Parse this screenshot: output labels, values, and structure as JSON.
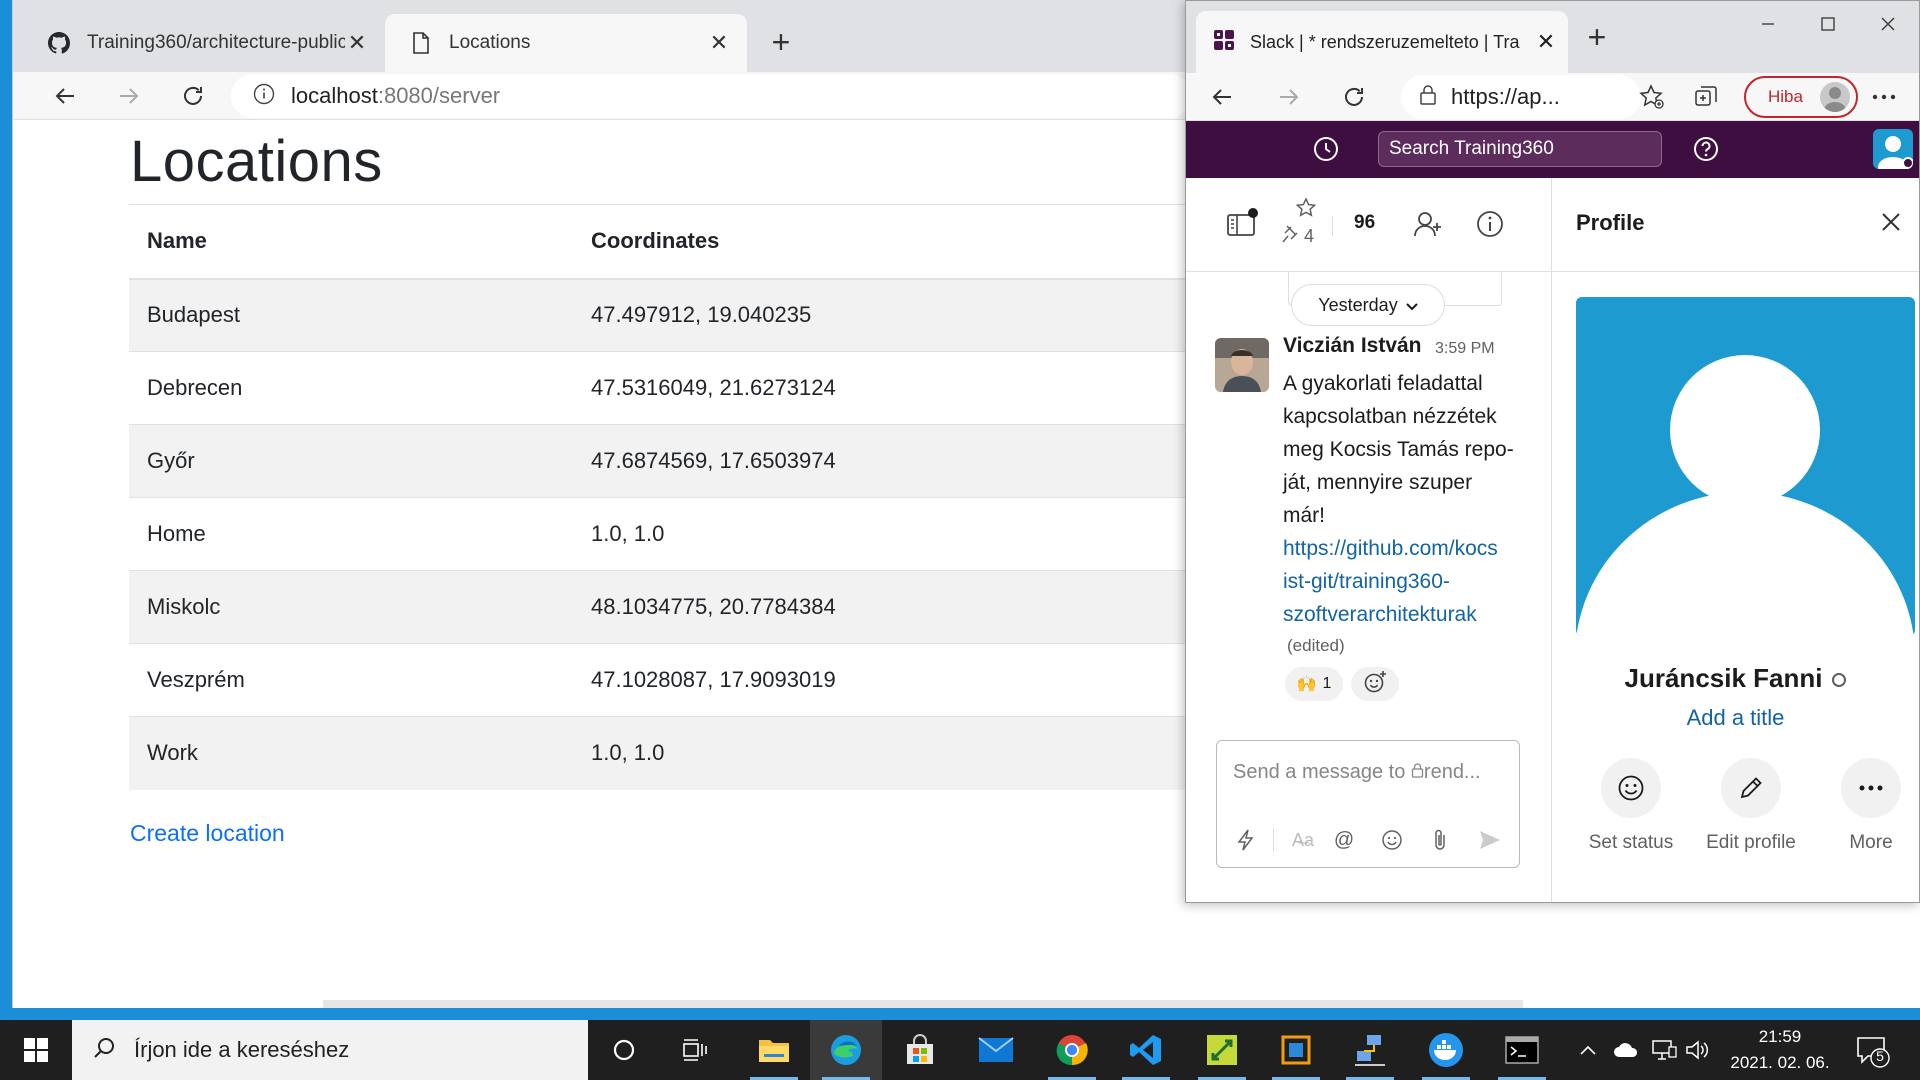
{
  "left_browser": {
    "tabs": [
      {
        "title": "Training360/architecture-public",
        "icon": "github-icon"
      },
      {
        "title": "Locations",
        "icon": "page-icon"
      }
    ],
    "url_host": "localhost",
    "url_path": ":8080/server"
  },
  "page": {
    "heading": "Locations",
    "columns": [
      "Name",
      "Coordinates"
    ],
    "rows": [
      {
        "name": "Budapest",
        "coords": "47.497912, 19.040235"
      },
      {
        "name": "Debrecen",
        "coords": "47.5316049, 21.6273124"
      },
      {
        "name": "Győr",
        "coords": "47.6874569, 17.6503974"
      },
      {
        "name": "Home",
        "coords": "1.0, 1.0"
      },
      {
        "name": "Miskolc",
        "coords": "48.1034775, 20.7784384"
      },
      {
        "name": "Veszprém",
        "coords": "47.1028087, 17.9093019"
      },
      {
        "name": "Work",
        "coords": "1.0, 1.0"
      }
    ],
    "create_link": "Create location"
  },
  "slack_window": {
    "tab_title": "Slack | * rendszeruzemelteto | Tra",
    "url": "https://ap...",
    "profile_button": "Hiba",
    "search_placeholder": "Search Training360",
    "header": {
      "pinned_count": "4",
      "member_count": "96"
    },
    "messages": {
      "date_divider": "Yesterday",
      "author": "Viczián István",
      "time": "3:59 PM",
      "text_lines": [
        "A gyakorlati feladattal",
        "kapcsolatban nézzétek",
        "meg Kocsis Tamás repo-",
        "ját, mennyire szuper",
        "már!"
      ],
      "link_lines": [
        "https://github.com/kocs",
        "ist-git/training360-",
        "szoftverarchitekturak"
      ],
      "edited": "(edited)",
      "reaction_emoji": "🙌",
      "reaction_count": "1"
    },
    "composer_placeholder": "Send a message to",
    "composer_channel": "rend...",
    "profile": {
      "title": "Profile",
      "name": "Juráncsik Fanni",
      "add_title": "Add a title",
      "actions": [
        {
          "label": "Set status",
          "icon": "smile-icon"
        },
        {
          "label": "Edit profile",
          "icon": "pencil-icon"
        },
        {
          "label": "More",
          "icon": "more-icon"
        }
      ]
    }
  },
  "taskbar": {
    "search_placeholder": "Írjon ide a kereséshez",
    "time": "21:59",
    "date": "2021. 02. 06.",
    "notification_count": "5"
  },
  "colors": {
    "slack_aubergine": "#3f0e40",
    "link_blue": "#0d6efd",
    "slack_link": "#1264a3",
    "error_red": "#c0262d",
    "taskbar": "#1f1f1f"
  }
}
